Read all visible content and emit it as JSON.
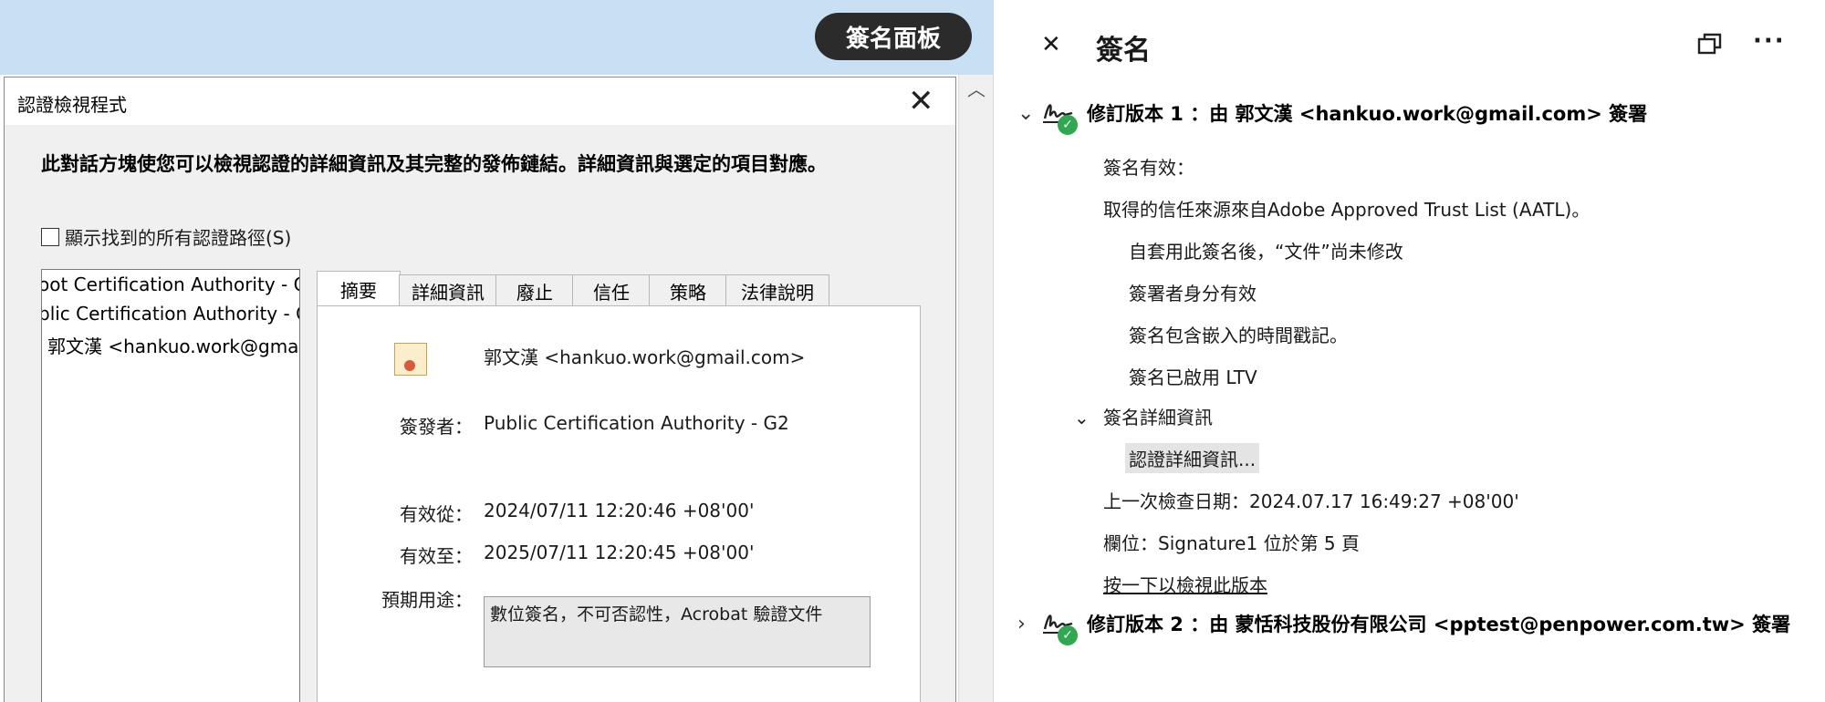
{
  "panel_pill": "簽名面板",
  "dialog": {
    "title": "認證檢視程式",
    "description": "此對話方塊使您可以檢視認證的詳細資訊及其完整的發佈鏈結。詳細資訊與選定的項目對應。",
    "show_all_label": "顯示找到的所有認證路徑(S)",
    "cert_list": [
      "oot Certification Authority - G",
      "blic Certification Authority - G",
      "郭文漢 <hankuo.work@gma"
    ],
    "tabs": [
      "摘要",
      "詳細資訊",
      "廢止",
      "信任",
      "策略",
      "法律說明"
    ],
    "summary": {
      "name": "郭文漢 <hankuo.work@gmail.com>",
      "issuer_label": "簽發者：",
      "issuer_value": "Public Certification Authority - G2",
      "valid_from_label": "有效從：",
      "valid_from_value": "2024/07/11 12:20:46 +08'00'",
      "valid_to_label": "有效至：",
      "valid_to_value": "2025/07/11 12:20:45 +08'00'",
      "purpose_label": "預期用途：",
      "purpose_value": "數位簽名，不可否認性，Acrobat 驗證文件"
    }
  },
  "sig_panel": {
    "title": "簽名",
    "rev1": "修訂版本 1 ：由 郭文漢 <hankuo.work@gmail.com> 簽署",
    "valid": "簽名有效：",
    "trust": "取得的信任來源來自Adobe Approved Trust List (AATL)。",
    "unmodified": "自套用此簽名後，“文件”尚未修改",
    "identity": "簽署者身分有效",
    "timestamp": "簽名包含嵌入的時間戳記。",
    "ltv": "簽名已啟用 LTV",
    "details_header": "簽名詳細資訊",
    "cert_details": "認證詳細資訊...",
    "last_checked": "上一次檢查日期：2024.07.17 16:49:27 +08'00'",
    "field": "欄位：Signature1 位於第 5 頁",
    "view_version": "按一下以檢視此版本",
    "rev2": "修訂版本 2 ：由 蒙恬科技股份有限公司 <pptest@penpower.com.tw> 簽署"
  }
}
